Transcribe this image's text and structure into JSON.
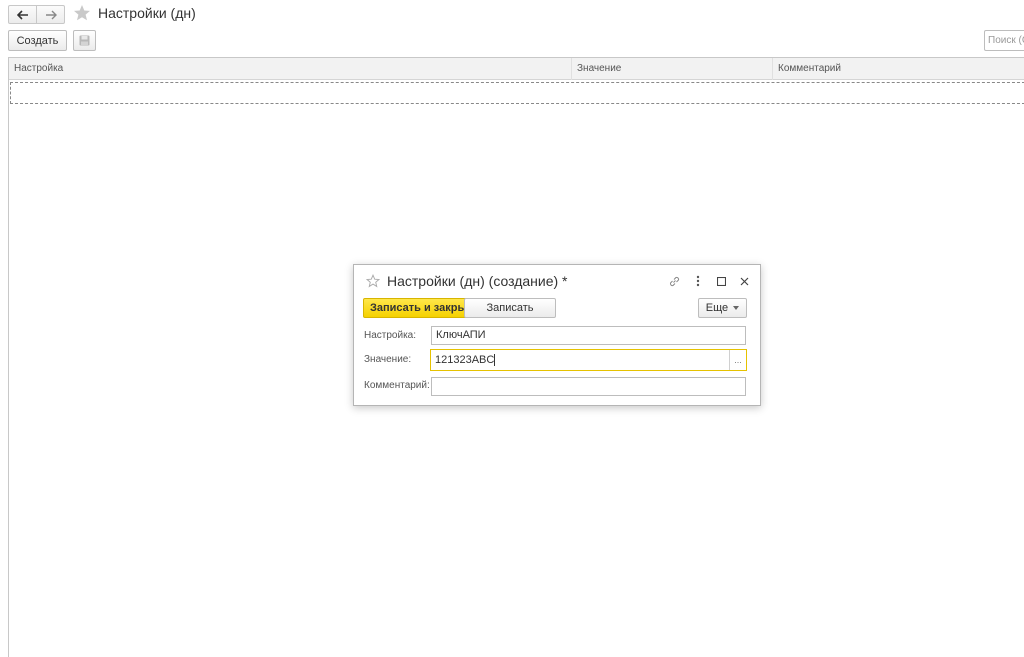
{
  "nav": {
    "back_icon": "arrow-left-icon",
    "forward_icon": "arrow-right-icon",
    "favorite_icon": "star-icon"
  },
  "page": {
    "title": "Настройки (дн)"
  },
  "toolbar": {
    "create_label": "Создать",
    "save_icon": "floppy-disk-icon",
    "search_placeholder": "Поиск (С"
  },
  "list": {
    "columns": [
      "Настройка",
      "Значение",
      "Комментарий"
    ]
  },
  "dialog": {
    "title": "Настройки (дн) (создание) *",
    "save_close_label": "Записать и закрыть",
    "save_label": "Записать",
    "more_label": "Еще",
    "fields": [
      {
        "label": "Настройка:",
        "value": "КлючАПИ"
      },
      {
        "label": "Значение:",
        "value": "121323ABC",
        "choice": "..."
      },
      {
        "label": "Комментарий:",
        "value": ""
      }
    ]
  },
  "colors": {
    "accent": "#f5d100",
    "active_border": "#e6c200",
    "border": "#c8c8c8"
  }
}
